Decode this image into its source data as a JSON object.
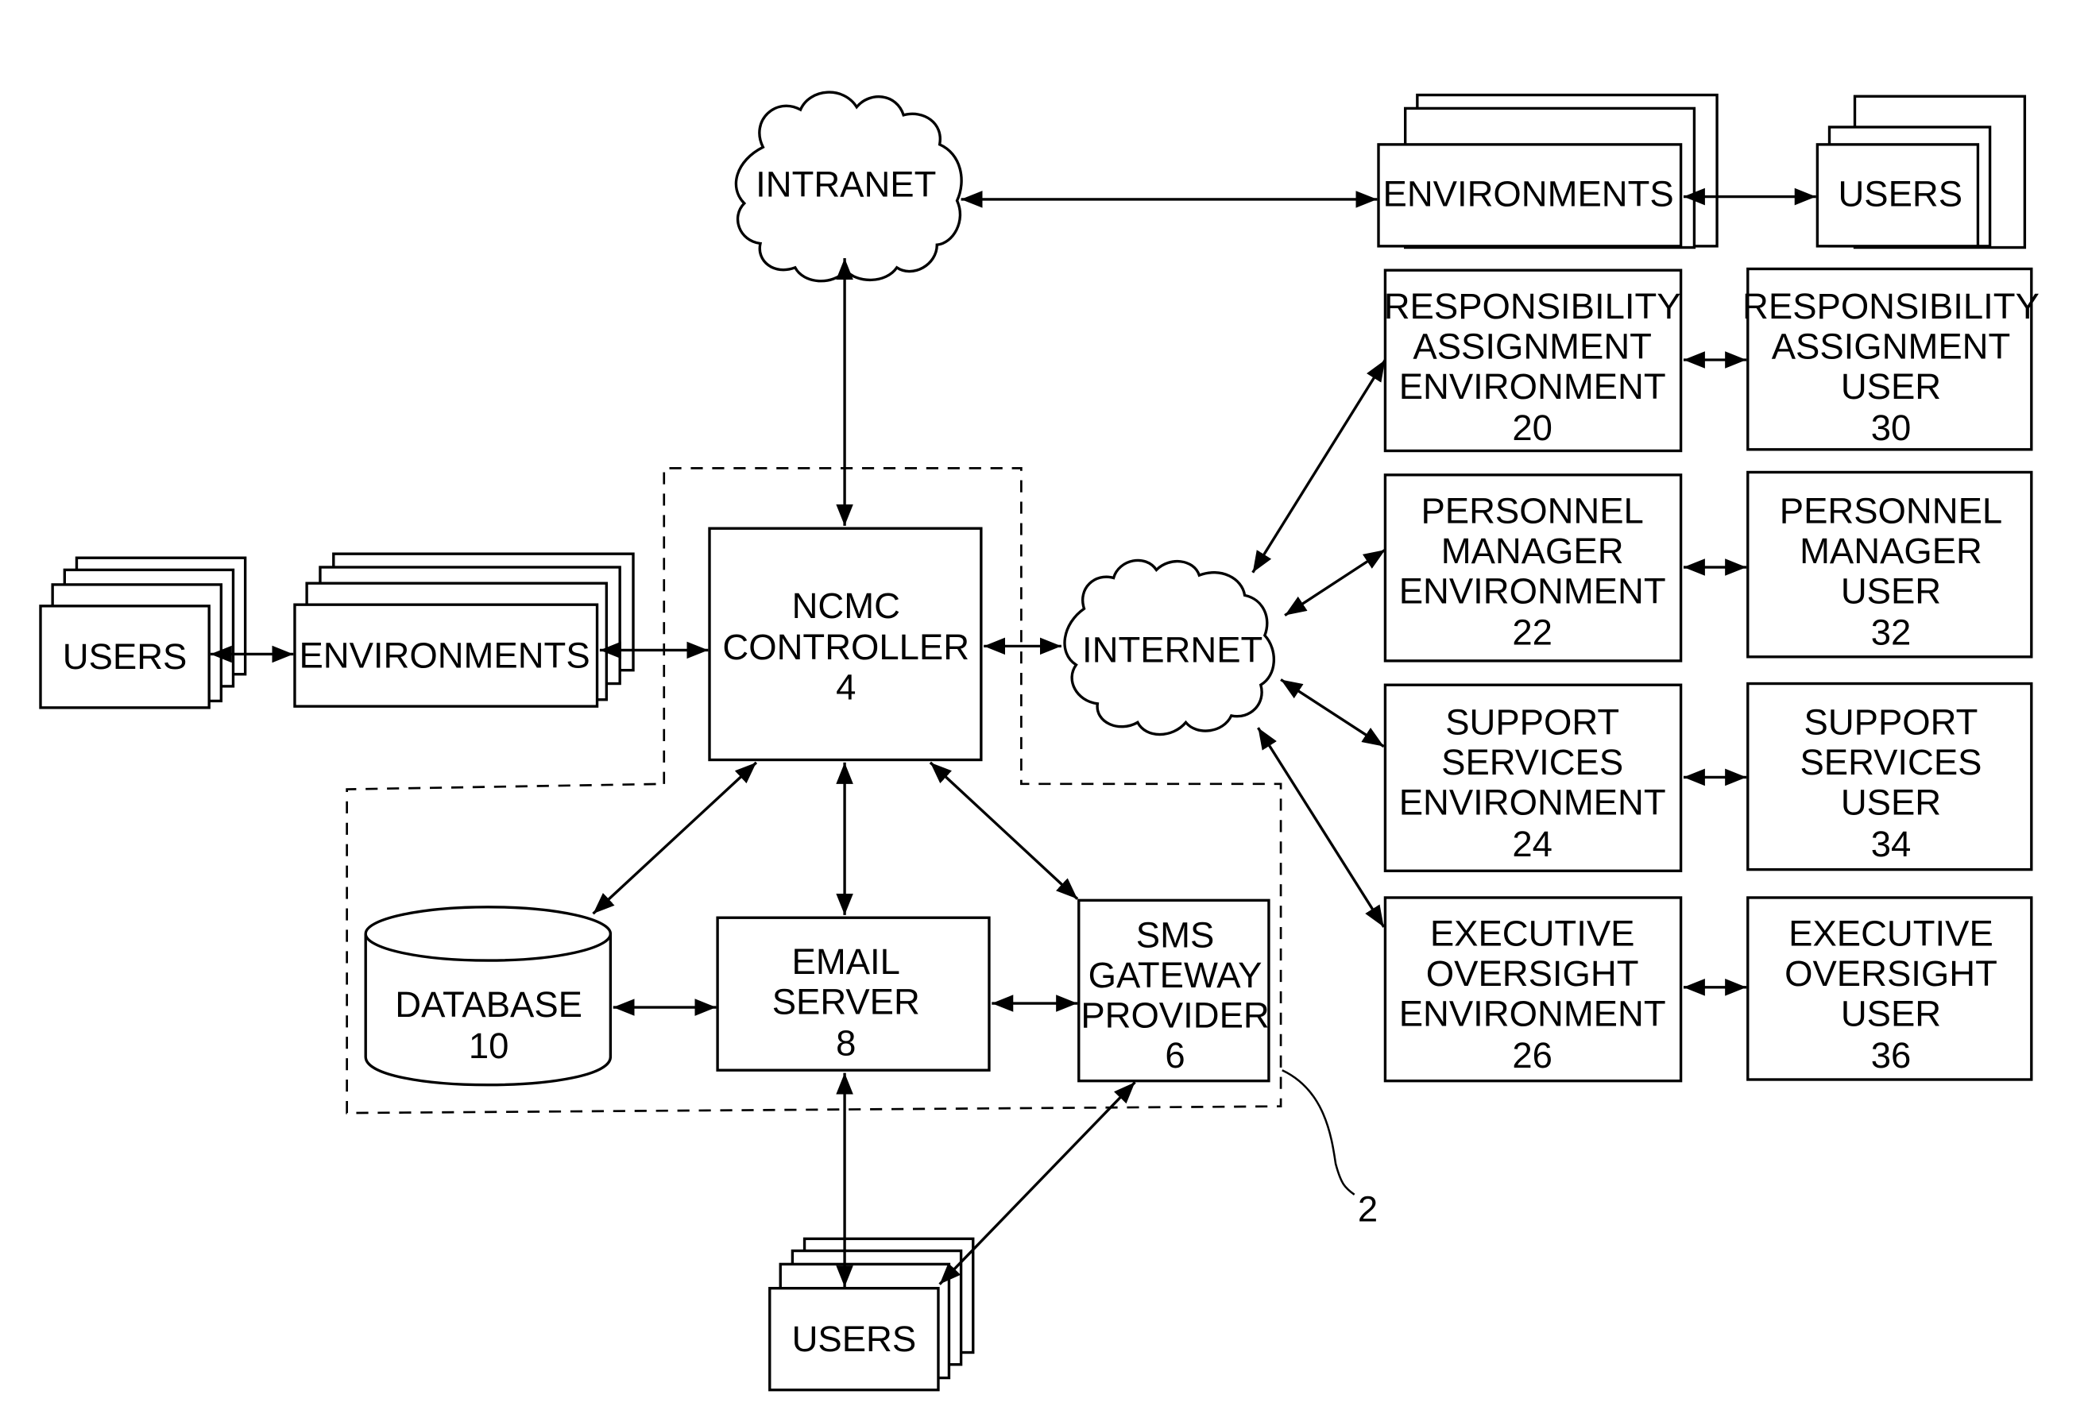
{
  "figure": {
    "system_ref": "2",
    "nodes": {
      "intranet": {
        "label": "INTRANET"
      },
      "internet": {
        "label": "INTERNET"
      },
      "controller": {
        "lines": [
          "NCMC",
          "CONTROLLER",
          "4"
        ]
      },
      "database": {
        "lines": [
          "DATABASE",
          "10"
        ]
      },
      "email_server": {
        "lines": [
          "EMAIL",
          "SERVER",
          "8"
        ]
      },
      "sms_gateway": {
        "lines": [
          "SMS",
          "GATEWAY",
          "PROVIDER",
          "6"
        ]
      },
      "top_environments": {
        "label": "ENVIRONMENTS"
      },
      "top_users": {
        "label": "USERS"
      },
      "left_environments": {
        "label": "ENVIRONMENTS"
      },
      "left_users": {
        "label": "USERS"
      },
      "bottom_users": {
        "label": "USERS"
      },
      "right_environments": [
        {
          "lines": [
            "RESPONSIBILITY",
            "ASSIGNMENT",
            "ENVIRONMENT",
            "20"
          ]
        },
        {
          "lines": [
            "PERSONNEL",
            "MANAGER",
            "ENVIRONMENT",
            "22"
          ]
        },
        {
          "lines": [
            "SUPPORT",
            "SERVICES",
            "ENVIRONMENT",
            "24"
          ]
        },
        {
          "lines": [
            "EXECUTIVE",
            "OVERSIGHT",
            "ENVIRONMENT",
            "26"
          ]
        }
      ],
      "right_users": [
        {
          "lines": [
            "RESPONSIBILITY",
            "ASSIGNMENT",
            "USER",
            "30"
          ]
        },
        {
          "lines": [
            "PERSONNEL",
            "MANAGER",
            "USER",
            "32"
          ]
        },
        {
          "lines": [
            "SUPPORT",
            "SERVICES",
            "USER",
            "34"
          ]
        },
        {
          "lines": [
            "EXECUTIVE",
            "OVERSIGHT",
            "USER",
            "36"
          ]
        }
      ]
    }
  }
}
